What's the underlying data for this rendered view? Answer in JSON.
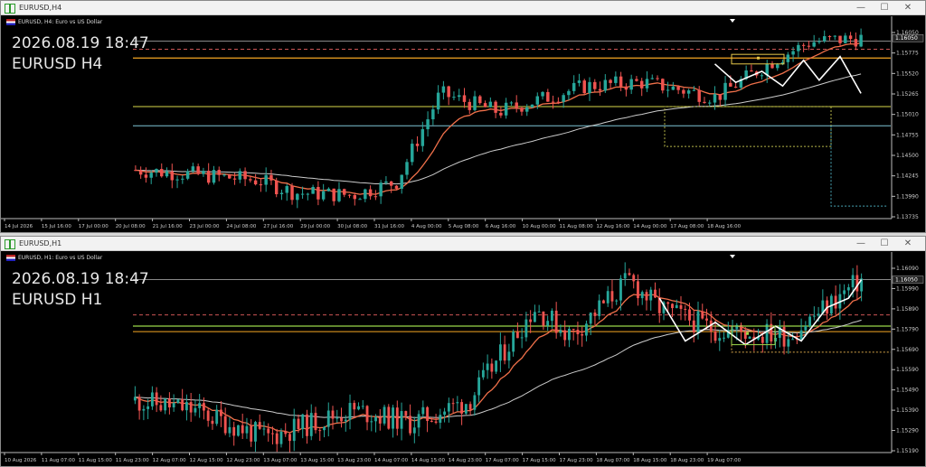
{
  "colors": {
    "bull": "#26a69a",
    "bear": "#ef5350",
    "ma_fast": "#f0704a",
    "ma_slow": "#cccccc",
    "zigzag": "#ffffff",
    "bg": "#000000",
    "grid_axis": "#bbbbbb"
  },
  "top": {
    "window_title": "EURUSD,H4",
    "info": "EURUSD, H4: Euro vs US Dollar",
    "time": "2026.08.19 18:47",
    "symbol": "EURUSD H4",
    "price_axis": [
      "1.16050",
      "1.15775",
      "1.15520",
      "1.15265",
      "1.15010",
      "1.14755",
      "1.14500",
      "1.14245",
      "1.13990",
      "1.13735"
    ],
    "time_axis": [
      "14 Jul 2026",
      "15 Jul 16:00",
      "17 Jul 00:00",
      "20 Jul 08:00",
      "21 Jul 16:00",
      "23 Jul 00:00",
      "24 Jul 08:00",
      "27 Jul 16:00",
      "29 Jul 00:00",
      "30 Jul 08:00",
      "31 Jul 16:00",
      "4 Aug 00:00",
      "5 Aug 08:00",
      "6 Aug 16:00",
      "10 Aug 00:00",
      "11 Aug 08:00",
      "12 Aug 16:00",
      "14 Aug 00:00",
      "17 Aug 08:00",
      "18 Aug 16:00"
    ],
    "current_price": "1.16050",
    "price_range": [
      1.136,
      1.162
    ]
  },
  "bottom": {
    "window_title": "EURUSD,H1",
    "info": "EURUSD, H1: Euro vs US Dollar",
    "time": "2026.08.19 18:47",
    "symbol": "EURUSD H1",
    "price_axis": [
      "1.16090",
      "1.15990",
      "1.15890",
      "1.15790",
      "1.15690",
      "1.15590",
      "1.15490",
      "1.15390",
      "1.15290",
      "1.15190"
    ],
    "time_axis": [
      "10 Aug 2026",
      "11 Aug 07:00",
      "11 Aug 15:00",
      "11 Aug 23:00",
      "12 Aug 07:00",
      "12 Aug 15:00",
      "12 Aug 23:00",
      "13 Aug 07:00",
      "13 Aug 15:00",
      "13 Aug 23:00",
      "14 Aug 07:00",
      "14 Aug 15:00",
      "14 Aug 23:00",
      "17 Aug 07:00",
      "17 Aug 15:00",
      "17 Aug 23:00",
      "18 Aug 07:00",
      "18 Aug 15:00",
      "18 Aug 23:00",
      "19 Aug 07:00"
    ],
    "current_price": "1.16050",
    "price_range": [
      1.1512,
      1.1614
    ]
  },
  "window_buttons": {
    "minimize": "—",
    "maximize": "☐",
    "close": "✕"
  }
}
